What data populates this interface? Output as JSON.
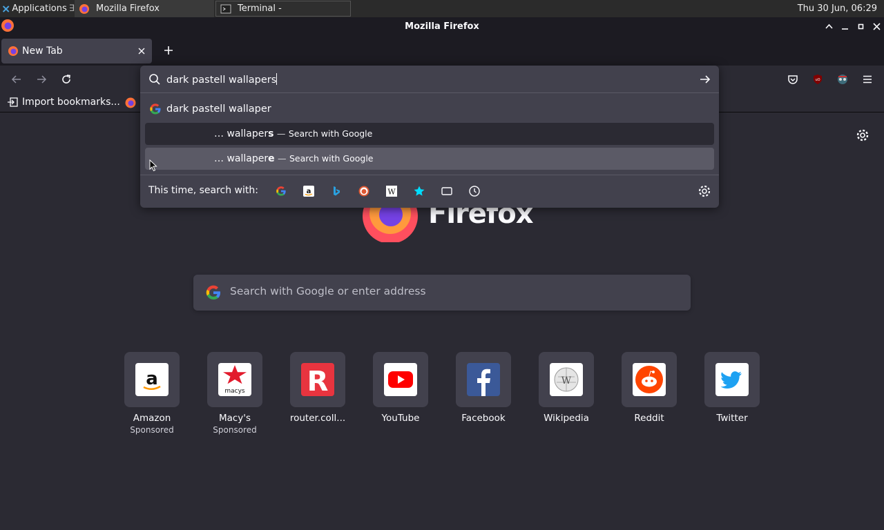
{
  "taskbar": {
    "apps_label": "Applications",
    "task_firefox": "Mozilla Firefox",
    "task_terminal": "Terminal -",
    "clock": "Thu 30 Jun, 06:29"
  },
  "window": {
    "title": "Mozilla Firefox"
  },
  "tabs": [
    {
      "label": "New Tab"
    }
  ],
  "bookmarks": {
    "import_label": "Import bookmarks..."
  },
  "urlbar": {
    "value": "dark pastell wallapers",
    "suggestions": [
      {
        "text": "dark pastell wallaper"
      },
      {
        "prefix": "… wallaper",
        "bold": "s",
        "dash": "—",
        "action": "Search with Google"
      },
      {
        "prefix": "… wallaper",
        "bold": "e",
        "dash": "—",
        "action": "Search with Google"
      }
    ],
    "oneoff_label": "This time, search with:",
    "engines": [
      "google-icon",
      "amazon-icon",
      "bing-icon",
      "duckduckgo-icon",
      "wikipedia-icon",
      "bookmarks-icon",
      "tabs-icon",
      "history-icon"
    ]
  },
  "ntp": {
    "wordmark": "Firefox",
    "search_placeholder": "Search with Google or enter address",
    "top_sites": [
      {
        "name": "Amazon",
        "sponsored": "Sponsored"
      },
      {
        "name": "Macy's",
        "sponsored": "Sponsored"
      },
      {
        "name": "router.coll...",
        "sponsored": ""
      },
      {
        "name": "YouTube",
        "sponsored": ""
      },
      {
        "name": "Facebook",
        "sponsored": ""
      },
      {
        "name": "Wikipedia",
        "sponsored": ""
      },
      {
        "name": "Reddit",
        "sponsored": ""
      },
      {
        "name": "Twitter",
        "sponsored": ""
      }
    ]
  },
  "colors": {
    "accent": "#00ddff",
    "popup_bg": "#42414d",
    "page_bg": "#2b2a33"
  }
}
